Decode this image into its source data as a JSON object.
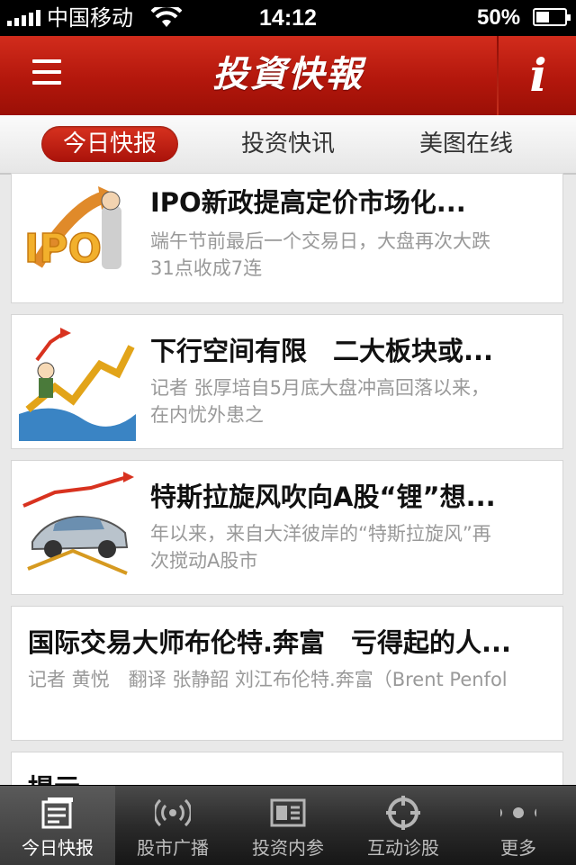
{
  "status_bar": {
    "carrier": "中国移动",
    "time": "14:12",
    "battery": "50%"
  },
  "navbar": {
    "title": "投資快報",
    "info_label": "i"
  },
  "tabs": [
    {
      "label": "今日快报",
      "active": true
    },
    {
      "label": "投资快讯",
      "active": false
    },
    {
      "label": "美图在线",
      "active": false
    }
  ],
  "articles": [
    {
      "headline": "IPO新政提高定价市场化...",
      "summary": "端午节前最后一个交易日，大盘再次大跌31点收成7连",
      "thumb_text": "IPO"
    },
    {
      "headline": "下行空间有限　二大板块或...",
      "summary": "记者 张厚培自5月底大盘冲高回落以来，在内忧外患之"
    },
    {
      "headline": "特斯拉旋风吹向A股“锂”想...",
      "summary": "年以来，来自大洋彼岸的“特斯拉旋风”再次搅动A股市"
    },
    {
      "headline": "国际交易大师布伦特.奔富　亏得起的人...",
      "summary": "记者 黄悦　翻译 张静韶 刘江布伦特.奔富（Brent Penfol"
    },
    {
      "headline": "提示"
    }
  ],
  "tabbar": [
    {
      "label": "今日快报",
      "icon": "news-icon",
      "active": true
    },
    {
      "label": "股市广播",
      "icon": "broadcast-icon",
      "active": false
    },
    {
      "label": "投资内参",
      "icon": "report-icon",
      "active": false
    },
    {
      "label": "互动诊股",
      "icon": "crosshair-icon",
      "active": false
    },
    {
      "label": "更多",
      "icon": "more-dots-icon",
      "active": false
    }
  ]
}
